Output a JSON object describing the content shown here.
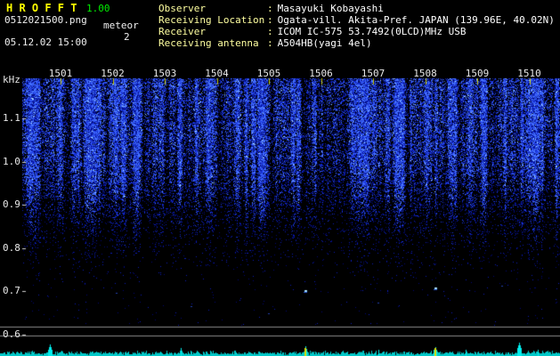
{
  "app": {
    "title": "H R O F F T",
    "version": "1.00",
    "filename": "0512021500.png",
    "counter_label": "meteor",
    "counter_value": "2",
    "timestamp": "05.12.02 15:00"
  },
  "info": {
    "separator": ":",
    "rows": [
      {
        "label": "Observer",
        "value": "Masayuki Kobayashi"
      },
      {
        "label": "Receiving Location",
        "value": "Ogata-vill. Akita-Pref. JAPAN (139.96E, 40.02N)"
      },
      {
        "label": "Receiver",
        "value": "ICOM IC-575 53.7492(0LCD)MHz USB"
      },
      {
        "label": "Receiving antenna",
        "value": "A504HB(yagi 4el)"
      }
    ]
  },
  "chart_data": {
    "type": "heatmap",
    "title": "HROFFT 10-minute radio meteor echo spectrogram",
    "x_axis": {
      "tick_labels": [
        "1501",
        "1502",
        "1503",
        "1504",
        "1505",
        "1506",
        "1507",
        "1508",
        "1509",
        "1510"
      ],
      "window_start": "1500",
      "span_minutes": 10
    },
    "y_axis": {
      "unit_label": "kHz",
      "tick_labels": [
        "1.1",
        "1.0",
        "0.9",
        "0.8",
        "0.7",
        "0.6"
      ],
      "range_khz": [
        0.6,
        1.2
      ]
    },
    "meteor_count": 2,
    "meteor_event_minutes": [
      5.7,
      8.2
    ],
    "meteor_echo_khz": [
      0.705,
      0.71
    ],
    "noise_profile": {
      "dense_band_khz": [
        0.95,
        1.2
      ],
      "fade_to_black_khz": 0.78,
      "palette": [
        "#020a78",
        "#0c1eb9",
        "#1e3ce6",
        "#4672ff",
        "#aaddff"
      ]
    },
    "signal_strip": {
      "kind": "signal-level-trace",
      "spikes": [
        {
          "minute": 0.8,
          "level": 13
        },
        {
          "minute": 3.3,
          "level": 9
        },
        {
          "minute": 5.7,
          "level": 11
        },
        {
          "minute": 8.2,
          "level": 10
        },
        {
          "minute": 9.8,
          "level": 15
        }
      ]
    }
  },
  "colors": {
    "background": "#000000",
    "title": "#ffff00",
    "version": "#00ee00",
    "header_text": "#f0f0f0",
    "info_label": "#ffffa0",
    "info_value": "#ffffff",
    "axis_text": "#e8e8e8",
    "minute_tick": "#cccc00",
    "grid_rule": "#8a8a8a",
    "signal_trace": "#00c8c8",
    "signal_trace_bright": "#00ecec",
    "meteor_marker": "#dddd00"
  }
}
